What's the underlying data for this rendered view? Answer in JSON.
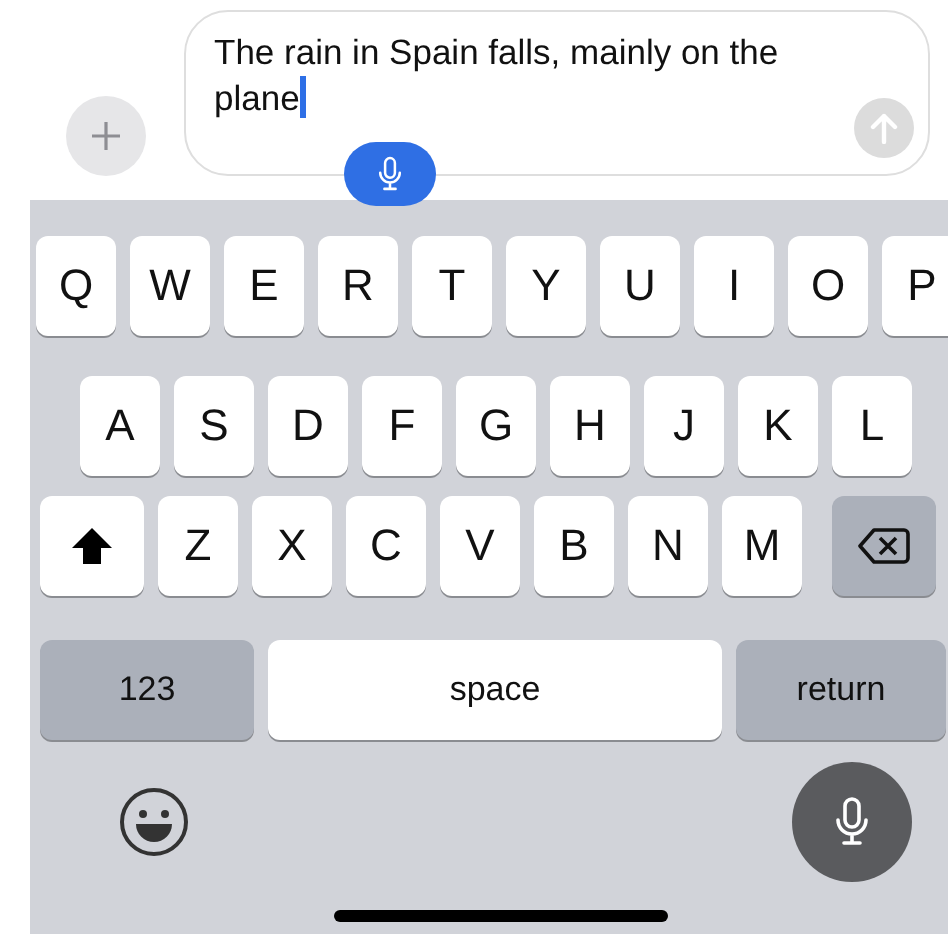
{
  "composer": {
    "value": "The rain in Spain falls, mainly on the plane"
  },
  "keyboard": {
    "rows": [
      {
        "keys": [
          {
            "kind": "letter",
            "label": "Q"
          },
          {
            "kind": "letter",
            "label": "W"
          },
          {
            "kind": "letter",
            "label": "E"
          },
          {
            "kind": "letter",
            "label": "R"
          },
          {
            "kind": "letter",
            "label": "T"
          },
          {
            "kind": "letter",
            "label": "Y"
          },
          {
            "kind": "letter",
            "label": "U"
          },
          {
            "kind": "letter",
            "label": "I"
          },
          {
            "kind": "letter",
            "label": "O"
          },
          {
            "kind": "letter",
            "label": "P"
          }
        ]
      },
      {
        "keys": [
          {
            "kind": "letter",
            "label": "A"
          },
          {
            "kind": "letter",
            "label": "S"
          },
          {
            "kind": "letter",
            "label": "D"
          },
          {
            "kind": "letter",
            "label": "F"
          },
          {
            "kind": "letter",
            "label": "G"
          },
          {
            "kind": "letter",
            "label": "H"
          },
          {
            "kind": "letter",
            "label": "J"
          },
          {
            "kind": "letter",
            "label": "K"
          },
          {
            "kind": "letter",
            "label": "L"
          }
        ]
      },
      {
        "keys": [
          {
            "kind": "shift"
          },
          {
            "kind": "letter",
            "label": "Z"
          },
          {
            "kind": "letter",
            "label": "X"
          },
          {
            "kind": "letter",
            "label": "C"
          },
          {
            "kind": "letter",
            "label": "V"
          },
          {
            "kind": "letter",
            "label": "B"
          },
          {
            "kind": "letter",
            "label": "N"
          },
          {
            "kind": "letter",
            "label": "M"
          },
          {
            "kind": "delete"
          }
        ]
      },
      {
        "keys": [
          {
            "kind": "function",
            "label": "123"
          },
          {
            "kind": "space",
            "label": "space"
          },
          {
            "kind": "function",
            "label": "return"
          }
        ]
      }
    ]
  }
}
